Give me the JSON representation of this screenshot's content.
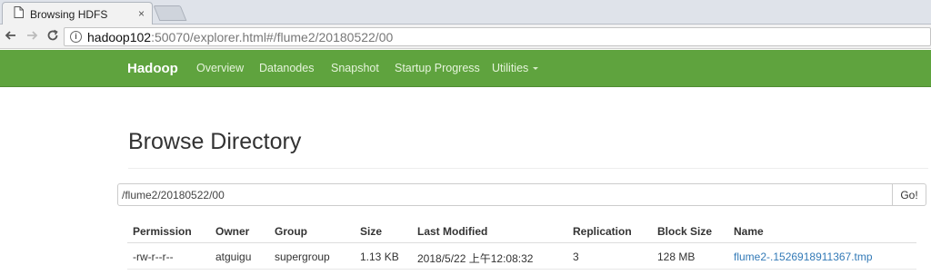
{
  "browser": {
    "tab_title": "Browsing HDFS",
    "tab_close": "×",
    "url_host": "hadoop102",
    "url_rest": ":50070/explorer.html#/flume2/20180522/00"
  },
  "navbar": {
    "brand": "Hadoop",
    "items": [
      "Overview",
      "Datanodes",
      "Snapshot",
      "Startup Progress",
      "Utilities"
    ]
  },
  "page": {
    "title": "Browse Directory",
    "path_value": "/flume2/20180522/00",
    "go_label": "Go!"
  },
  "table": {
    "headers": [
      "Permission",
      "Owner",
      "Group",
      "Size",
      "Last Modified",
      "Replication",
      "Block Size",
      "Name"
    ],
    "rows": [
      {
        "permission": "-rw-r--r--",
        "owner": "atguigu",
        "group": "supergroup",
        "size": "1.13 KB",
        "last_modified": "2018/5/22 上午12:08:32",
        "replication": "3",
        "block_size": "128 MB",
        "name": "flume2-.1526918911367.tmp"
      }
    ]
  },
  "colors": {
    "navbar_bg": "#5fa33e",
    "link": "#337ab7"
  }
}
